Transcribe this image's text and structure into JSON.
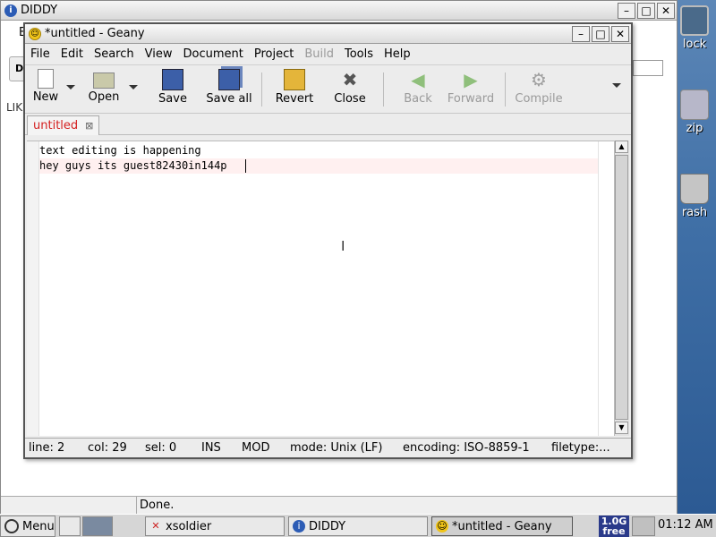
{
  "desktop": {
    "icons": [
      {
        "label": "lock",
        "icon": "lock-icon"
      },
      {
        "label": "zip",
        "icon": "zip-archive-icon"
      },
      {
        "label": "rash",
        "icon": "trash-icon"
      }
    ]
  },
  "diddy_window": {
    "title": "DIDDY",
    "peek_text_b": "E",
    "peek_text_d": "D",
    "peek_text_lik": "LIK",
    "status_text": "Done."
  },
  "geany": {
    "title": "*untitled - Geany",
    "menu": [
      "File",
      "Edit",
      "Search",
      "View",
      "Document",
      "Project",
      "Build",
      "Tools",
      "Help"
    ],
    "toolbar": {
      "new": "New",
      "open": "Open",
      "save": "Save",
      "save_all": "Save all",
      "revert": "Revert",
      "close": "Close",
      "back": "Back",
      "forward": "Forward",
      "compile": "Compile"
    },
    "tab": {
      "label": "untitled"
    },
    "editor": {
      "lines": [
        "text editing is happening",
        "hey guys its guest82430in144p"
      ]
    },
    "status": {
      "line": "line: 2",
      "col": "col: 29",
      "sel": "sel: 0",
      "ins": "INS",
      "mod": "MOD",
      "mode": "mode: Unix (LF)",
      "encoding": "encoding: ISO-8859-1",
      "filetype": "filetype:..."
    }
  },
  "taskbar": {
    "menu_label": "Menu",
    "tasks": [
      {
        "label": "xsoldier"
      },
      {
        "label": "DIDDY"
      },
      {
        "label": "*untitled - Geany"
      }
    ],
    "memory_line1": "1.0G",
    "memory_line2": "free",
    "clock": "01:12 AM"
  }
}
